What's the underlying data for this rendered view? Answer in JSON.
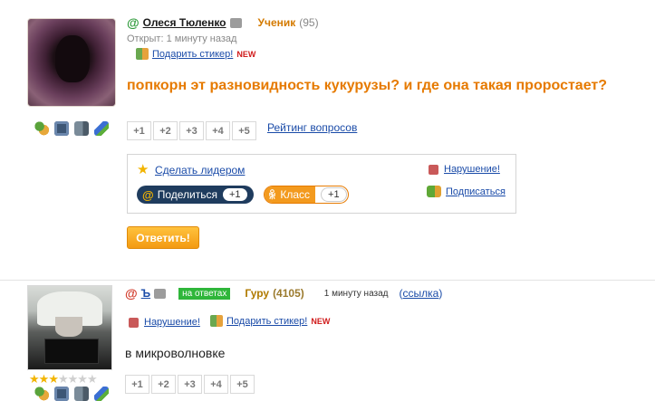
{
  "question": {
    "author_name": "Олеся Тюленко",
    "author_rank": "Ученик",
    "author_points": "(95)",
    "opened": "Открыт: 1 минуту назад",
    "gift_sticker": "Подарить стикер!",
    "new_badge": "NEW",
    "text": "попкорн эт разновидность кукурузы? и где она такая проростает?",
    "votes": [
      "+1",
      "+2",
      "+3",
      "+4",
      "+5"
    ],
    "rating_link": "Рейтинг вопросов",
    "make_leader": "Сделать лидером",
    "share_label": "Поделиться",
    "share_count": "+1",
    "class_label": "Класс",
    "class_count": "+1",
    "violation": "Нарушение!",
    "subscribe": "Подписаться",
    "reply_button": "Ответить!"
  },
  "answer": {
    "author_name": "Ъ",
    "badge": "на ответах",
    "rank": "Гуру",
    "points": "(4105)",
    "time": "1 минуту назад",
    "link_open": "(",
    "link_text": "ссылка",
    "link_close": ")",
    "violation": "Нарушение!",
    "gift_sticker": "Подарить стикер!",
    "new_badge": "NEW",
    "text": "в микроволновке",
    "votes": [
      "+1",
      "+2",
      "+3",
      "+4",
      "+5"
    ],
    "stars_filled": 3,
    "stars_total": 7
  },
  "icons": [
    "people-icon",
    "photo-icon",
    "video-icon",
    "pencil-icon",
    "mail-icon",
    "star-icon",
    "warning-icon",
    "gift-icon",
    "subscribe-icon"
  ],
  "colors": {
    "accent_orange": "#e67a00",
    "link_blue": "#1a4ba8",
    "online_green": "#2f9a3b",
    "share_pill": "#1f3c5e"
  }
}
